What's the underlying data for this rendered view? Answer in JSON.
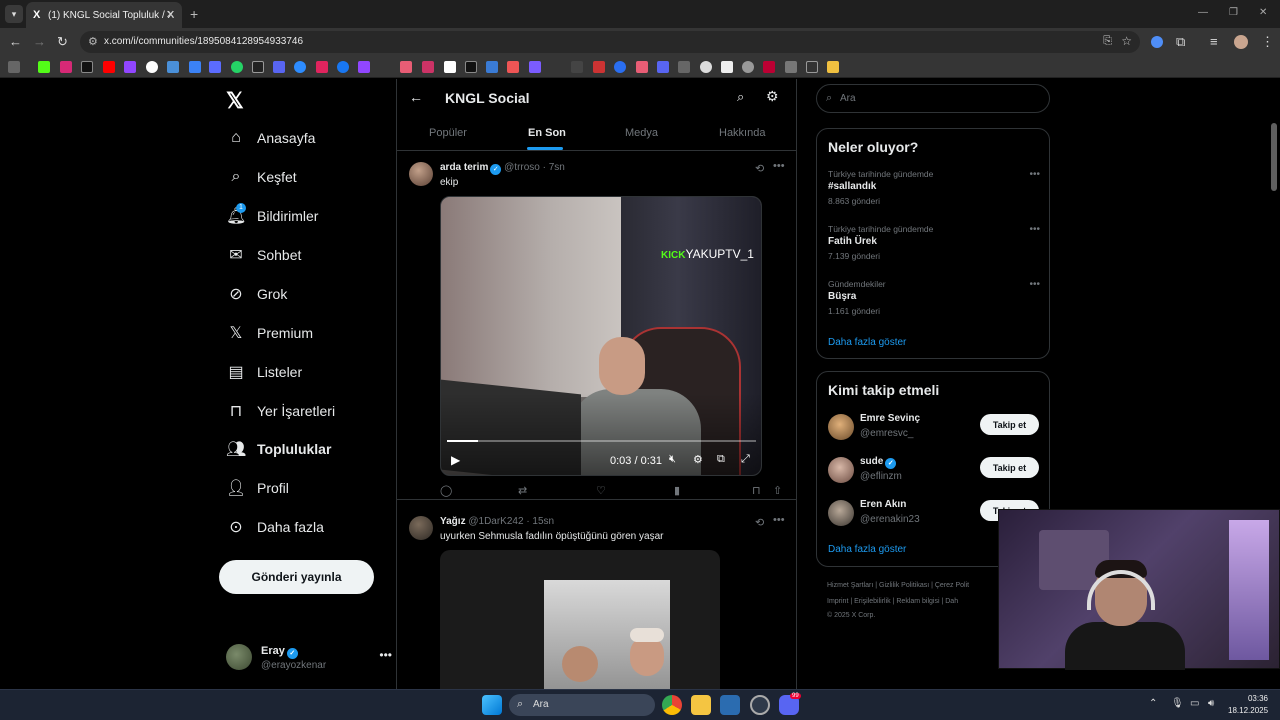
{
  "browser": {
    "tab_title": "(1) KNGL Social Topluluk / X",
    "url": "x.com/i/communities/1895084128954933746",
    "new_tab": "+",
    "tab_close": "✕"
  },
  "sidebar": {
    "items": [
      {
        "label": "Anasayfa",
        "icon": "home-icon",
        "glyph": "⌂"
      },
      {
        "label": "Keşfet",
        "icon": "search-icon",
        "glyph": "⌕"
      },
      {
        "label": "Bildirimler",
        "icon": "bell-icon",
        "glyph": "🔔︎",
        "badge": "1"
      },
      {
        "label": "Sohbet",
        "icon": "mail-icon",
        "glyph": "✉"
      },
      {
        "label": "Grok",
        "icon": "grok-icon",
        "glyph": "⊘"
      },
      {
        "label": "Premium",
        "icon": "x-icon",
        "glyph": "𝕏"
      },
      {
        "label": "Listeler",
        "icon": "list-icon",
        "glyph": "▤"
      },
      {
        "label": "Yer İşaretleri",
        "icon": "bookmark-icon",
        "glyph": "⊓"
      },
      {
        "label": "Topluluklar",
        "icon": "people-icon",
        "glyph": "👥︎"
      },
      {
        "label": "Profil",
        "icon": "person-icon",
        "glyph": "👤︎"
      },
      {
        "label": "Daha fazla",
        "icon": "more-circle-icon",
        "glyph": "⊙"
      }
    ],
    "post_button": "Gönderi yayınla",
    "account": {
      "name": "Eray",
      "handle": "@erayozkenar"
    }
  },
  "header": {
    "title": "KNGL Social",
    "tabs": [
      "Popüler",
      "En Son",
      "Medya",
      "Hakkında"
    ],
    "active_tab": "En Son"
  },
  "tweets": [
    {
      "name": "arda terim",
      "handle": "@trroso",
      "time": "· 7sn",
      "text": "ekip",
      "video": {
        "overlay": "YAKUPTV_1",
        "overlay_brand": "KICK",
        "time": "0:03 / 0:31",
        "progress": 0.1
      }
    },
    {
      "name": "Yağız",
      "handle": "@1DarK242",
      "time": "· 15sn",
      "text": "uyurken Sehmusla fadılın öpüştüğünü gören yaşar"
    }
  ],
  "right": {
    "search_placeholder": "Ara",
    "trends_title": "Neler oluyor?",
    "trends": [
      {
        "context": "Türkiye tarihinde gündemde",
        "name": "#sallandık",
        "count": "8.863 gönderi"
      },
      {
        "context": "Türkiye tarihinde gündemde",
        "name": "Fatih Ürek",
        "count": "7.139 gönderi"
      },
      {
        "context": "Gündemdekiler",
        "name": "Büşra",
        "count": "1.161 gönderi"
      }
    ],
    "show_more": "Daha fazla göster",
    "who_title": "Kimi takip etmeli",
    "who": [
      {
        "name": "Emre Sevinç",
        "handle": "@emresvc_",
        "verified": false
      },
      {
        "name": "sude",
        "handle": "@eflinzm",
        "verified": true
      },
      {
        "name": "Eren Akın",
        "handle": "@erenakin23",
        "verified": false
      }
    ],
    "follow_label": "Takip et",
    "footer_line1": "Hizmet Şartları  |  Gizlilik Politikası  |  Çerez Polit",
    "footer_line2": "Imprint  |  Erişilebilirlik  |  Reklam bilgisi  |  Dah",
    "footer_line3": "© 2025 X Corp."
  },
  "taskbar": {
    "search": "Ara",
    "time": "03:36",
    "date": "18.12.2025",
    "discord_badge": "99"
  },
  "colors": {
    "accent": "#1d9bf0",
    "background": "#000000",
    "border": "#2f3336",
    "muted": "#71767b"
  }
}
